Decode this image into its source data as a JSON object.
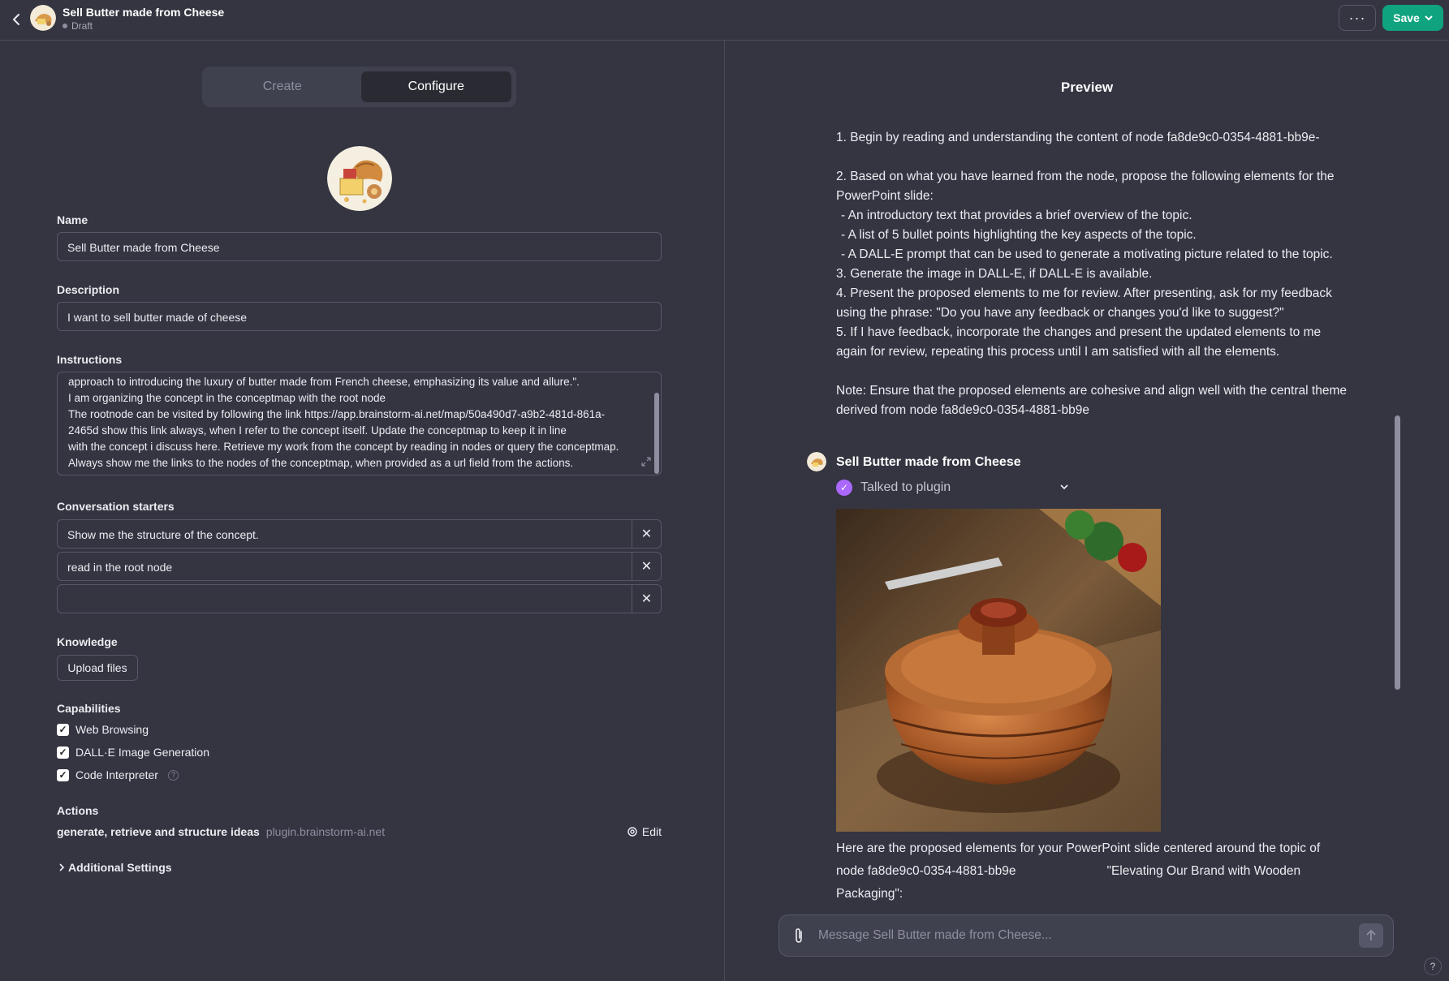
{
  "header": {
    "title": "Sell Butter made from Cheese",
    "status": "Draft",
    "more_label": "···",
    "save_label": "Save"
  },
  "tabs": [
    {
      "label": "Create",
      "active": false
    },
    {
      "label": "Configure",
      "active": true
    }
  ],
  "form": {
    "name_label": "Name",
    "name_value": "Sell Butter made from Cheese",
    "description_label": "Description",
    "description_value": "I want to sell butter made of cheese",
    "instructions_label": "Instructions",
    "instructions_lines": [
      "approach to introducing the luxury of butter made from French cheese, emphasizing its value and allure.\".",
      "I am organizing the concept in the conceptmap with the root node",
      "The rootnode can be visited by following the link https://app.brainstorm-ai.net/map/50a490d7-a9b2-481d-861a-",
      "2465d               show this link always, when I refer to the concept itself. Update the conceptmap to keep it in line",
      "with the concept i discuss here. Retrieve my work from the concept by reading in nodes or query the conceptmap.",
      "Always show me the links to the nodes of the conceptmap, when provided as a url field from the actions."
    ],
    "starters_label": "Conversation starters",
    "starters": [
      "Show me the structure of the concept.",
      "read in  the root node",
      ""
    ],
    "knowledge_label": "Knowledge",
    "upload_label": "Upload files",
    "capabilities_label": "Capabilities",
    "capabilities": [
      {
        "label": "Web Browsing",
        "checked": true
      },
      {
        "label": "DALL·E Image Generation",
        "checked": true
      },
      {
        "label": "Code Interpreter",
        "checked": true
      }
    ],
    "actions_label": "Actions",
    "action_name": "generate, retrieve and structure ideas",
    "action_domain": "plugin.brainstorm-ai.net",
    "edit_label": "Edit",
    "additional_label": "Additional Settings"
  },
  "preview": {
    "title": "Preview",
    "paragraphs": [
      "1. Begin by reading and understanding the content of node fa8de9c0-0354-4881-bb9e-",
      "",
      "2. Based on what you have learned from the node, propose the following elements for the",
      "PowerPoint slide:",
      "  - An introductory text that provides a brief overview of the topic.",
      "  - A list of 5 bullet points highlighting the key aspects of the topic.",
      "  - A DALL-E prompt that can be used to generate a motivating picture related to the topic.",
      "3. Generate the image in DALL-E, if DALL-E is available.",
      "4. Present the proposed elements to me for review. After presenting, ask for my feedback",
      "using the phrase: \"Do you have any feedback or changes you'd like to suggest?\"",
      "5. If I have feedback, incorporate the changes and present the updated elements to me",
      "again for review, repeating this process until I am satisfied with all the elements.",
      "",
      "Note: Ensure that the proposed elements are cohesive and align well with the central theme",
      "derived from node fa8de9c0-0354-4881-bb9e"
    ],
    "bot_name": "Sell Butter made from Cheese",
    "plugin_status": "Talked to plugin",
    "reply_lines": [
      "Here are the proposed elements for your PowerPoint slide centered around the topic of",
      "node fa8de9c0-0354-4881-bb9e                          \"Elevating Our Brand with Wooden",
      "Packaging\":"
    ],
    "composer_placeholder": "Message Sell Butter made from Cheese..."
  },
  "help_label": "?",
  "colors": {
    "background": "#343541",
    "accent": "#10a37f",
    "plugin": "#ab68ff"
  }
}
